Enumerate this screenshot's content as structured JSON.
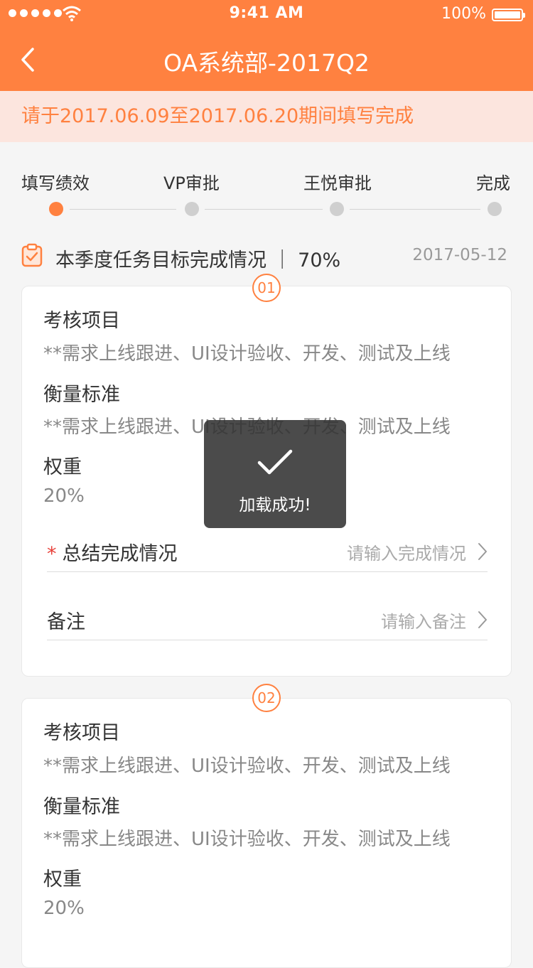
{
  "status_bar": {
    "time": "9:41 AM",
    "battery": "100%"
  },
  "nav": {
    "title": "OA系统部-2017Q2",
    "back_icon": "chevron-left-icon"
  },
  "banner": {
    "text": "请于2017.06.09至2017.06.20期间填写完成"
  },
  "steps": [
    {
      "label": "填写绩效",
      "active": true
    },
    {
      "label": "VP审批",
      "active": false
    },
    {
      "label": "王悦审批",
      "active": false
    },
    {
      "label": "完成",
      "active": false
    }
  ],
  "section": {
    "title": "本季度任务目标完成情况 ｜ 70%",
    "date": "2017-05-12",
    "icon": "clipboard-check-icon"
  },
  "cards": [
    {
      "index": "01",
      "item_label": "考核项目",
      "item_value": "**需求上线跟进、UI设计验收、开发、测试及上线",
      "standard_label": "衡量标准",
      "standard_value": "**需求上线跟进、UI设计验收、开发、测试及上线",
      "weight_label": "权重",
      "weight_value": "20%",
      "summary_required": "*",
      "summary_label": "总结完成情况",
      "summary_placeholder": "请输入完成情况",
      "remark_label": "备注",
      "remark_placeholder": "请输入备注"
    },
    {
      "index": "02",
      "item_label": "考核项目",
      "item_value": "**需求上线跟进、UI设计验收、开发、测试及上线",
      "standard_label": "衡量标准",
      "standard_value": "**需求上线跟进、UI设计验收、开发、测试及上线",
      "weight_label": "权重",
      "weight_value": "20%"
    }
  ],
  "toast": {
    "text": "加载成功!",
    "icon": "checkmark-icon"
  },
  "colors": {
    "accent": "#ff8140",
    "banner_bg": "#fce5de",
    "required": "#e8413a"
  }
}
